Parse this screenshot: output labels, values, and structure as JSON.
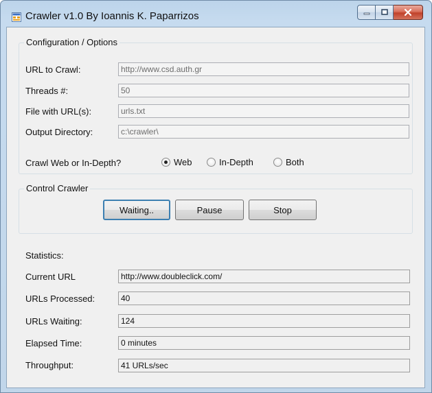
{
  "window": {
    "title": "Crawler v1.0 By Ioannis K. Paparrizos",
    "icon": "window-app-icon"
  },
  "config": {
    "legend": "Configuration / Options",
    "url_label": "URL to Crawl:",
    "url_value": "http://www.csd.auth.gr",
    "threads_label": "Threads #:",
    "threads_value": "50",
    "file_label": "File with URL(s):",
    "file_value": "urls.txt",
    "output_label": "Output Directory:",
    "output_value": "c:\\crawler\\",
    "mode_label": "Crawl Web or In-Depth?",
    "mode_options": [
      "Web",
      "In-Depth",
      "Both"
    ],
    "mode_selected": "Web"
  },
  "control": {
    "legend": "Control Crawler",
    "start_label": "Waiting..",
    "pause_label": "Pause",
    "stop_label": "Stop"
  },
  "stats": {
    "heading": "Statistics:",
    "current_url_label": "Current URL",
    "current_url_value": "http://www.doubleclick.com/",
    "processed_label": "URLs Processed:",
    "processed_value": "40",
    "waiting_label": "URLs Waiting:",
    "waiting_value": "124",
    "elapsed_label": "Elapsed Time:",
    "elapsed_value": "0 minutes",
    "throughput_label": "Throughput:",
    "throughput_value": "41 URLs/sec"
  }
}
